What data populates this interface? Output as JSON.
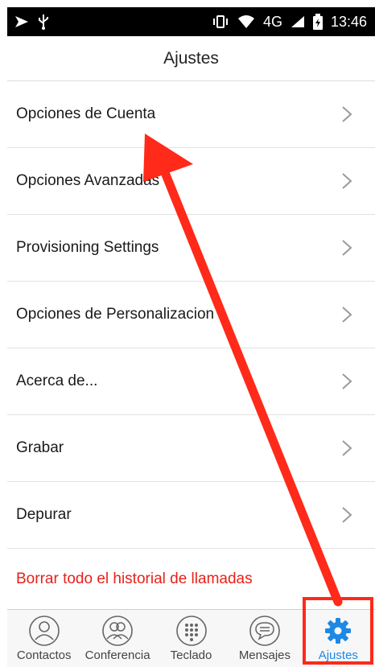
{
  "status_bar": {
    "time": "13:46",
    "network": "4G",
    "icons": [
      "cast-icon",
      "usb-icon",
      "vibrate-icon",
      "wifi-icon",
      "signal-icon",
      "battery-icon"
    ]
  },
  "header": {
    "title": "Ajustes"
  },
  "settings": {
    "items": [
      {
        "label": "Opciones de Cuenta"
      },
      {
        "label": "Opciones Avanzadas"
      },
      {
        "label": "Provisioning Settings"
      },
      {
        "label": "Opciones de Personalizacion"
      },
      {
        "label": "Acerca de..."
      },
      {
        "label": "Grabar"
      },
      {
        "label": "Depurar"
      }
    ],
    "clear_history": "Borrar todo el historial de llamadas"
  },
  "tabs": [
    {
      "label": "Contactos",
      "icon": "contacts-icon"
    },
    {
      "label": "Conferencia",
      "icon": "conference-icon"
    },
    {
      "label": "Teclado",
      "icon": "keypad-icon"
    },
    {
      "label": "Mensajes",
      "icon": "messages-icon"
    },
    {
      "label": "Ajustes",
      "icon": "gear-icon",
      "active": true
    }
  ],
  "colors": {
    "accent": "#1e88e5",
    "danger": "#e8211a",
    "annotation": "#ff2a1a"
  }
}
